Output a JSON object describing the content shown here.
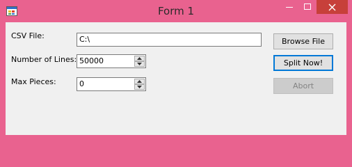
{
  "window": {
    "title": "Form 1",
    "colors": {
      "frame": "#e9628f",
      "close": "#c7403a",
      "client": "#f0f0f0"
    }
  },
  "fields": {
    "csv_file_label": "CSV File:",
    "csv_file_value": "C:\\",
    "lines_label": "Number of Lines:",
    "lines_value": "50000",
    "pieces_label": "Max Pieces:",
    "pieces_value": "0"
  },
  "buttons": {
    "browse": "Browse File",
    "split": "Split Now!",
    "abort": "Abort"
  },
  "icons": {
    "app": "form-icon",
    "minimize": "minimize-icon",
    "maximize": "maximize-icon",
    "close": "close-icon",
    "spin_up": "arrow-up-icon",
    "spin_down": "arrow-down-icon"
  }
}
